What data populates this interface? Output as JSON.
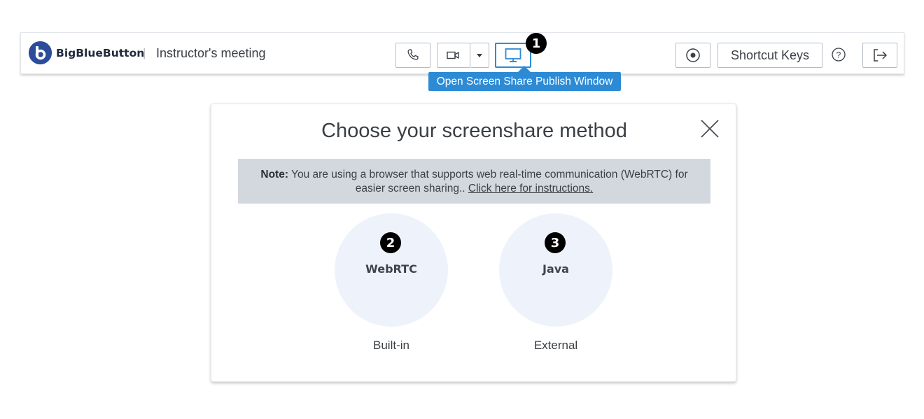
{
  "header": {
    "brand": "BigBlueButton",
    "separator": "|",
    "meeting_title": "Instructor's meeting",
    "icons": {
      "logo": "bigbluebutton-logo-icon",
      "phone": "phone-icon",
      "video": "video-camera-icon",
      "video_menu": "caret-down-icon",
      "screen_share": "monitor-icon",
      "record": "record-icon",
      "help": "help-circle-icon",
      "logout": "logout-icon"
    },
    "shortcut_keys_label": "Shortcut Keys"
  },
  "tooltip": {
    "text": "Open Screen Share Publish Window"
  },
  "annotations": {
    "badge_1": "1",
    "badge_2": "2",
    "badge_3": "3"
  },
  "modal": {
    "title": "Choose your screenshare method",
    "close_icon": "close-icon",
    "note": {
      "label": "Note:",
      "text_line1": "You are using a browser that supports web real-time communication (WebRTC) for",
      "text_line2": "easier screen sharing..",
      "link": "Click here for instructions."
    },
    "methods": [
      {
        "label": "WebRTC",
        "sub": "Built-in"
      },
      {
        "label": "Java",
        "sub": "External"
      }
    ]
  },
  "colors": {
    "accent": "#2d8bd6",
    "brand_blue": "#2b4c9a",
    "note_bg": "#d3d8de",
    "method_bg": "#eef3fb",
    "text": "#3a3f45"
  }
}
